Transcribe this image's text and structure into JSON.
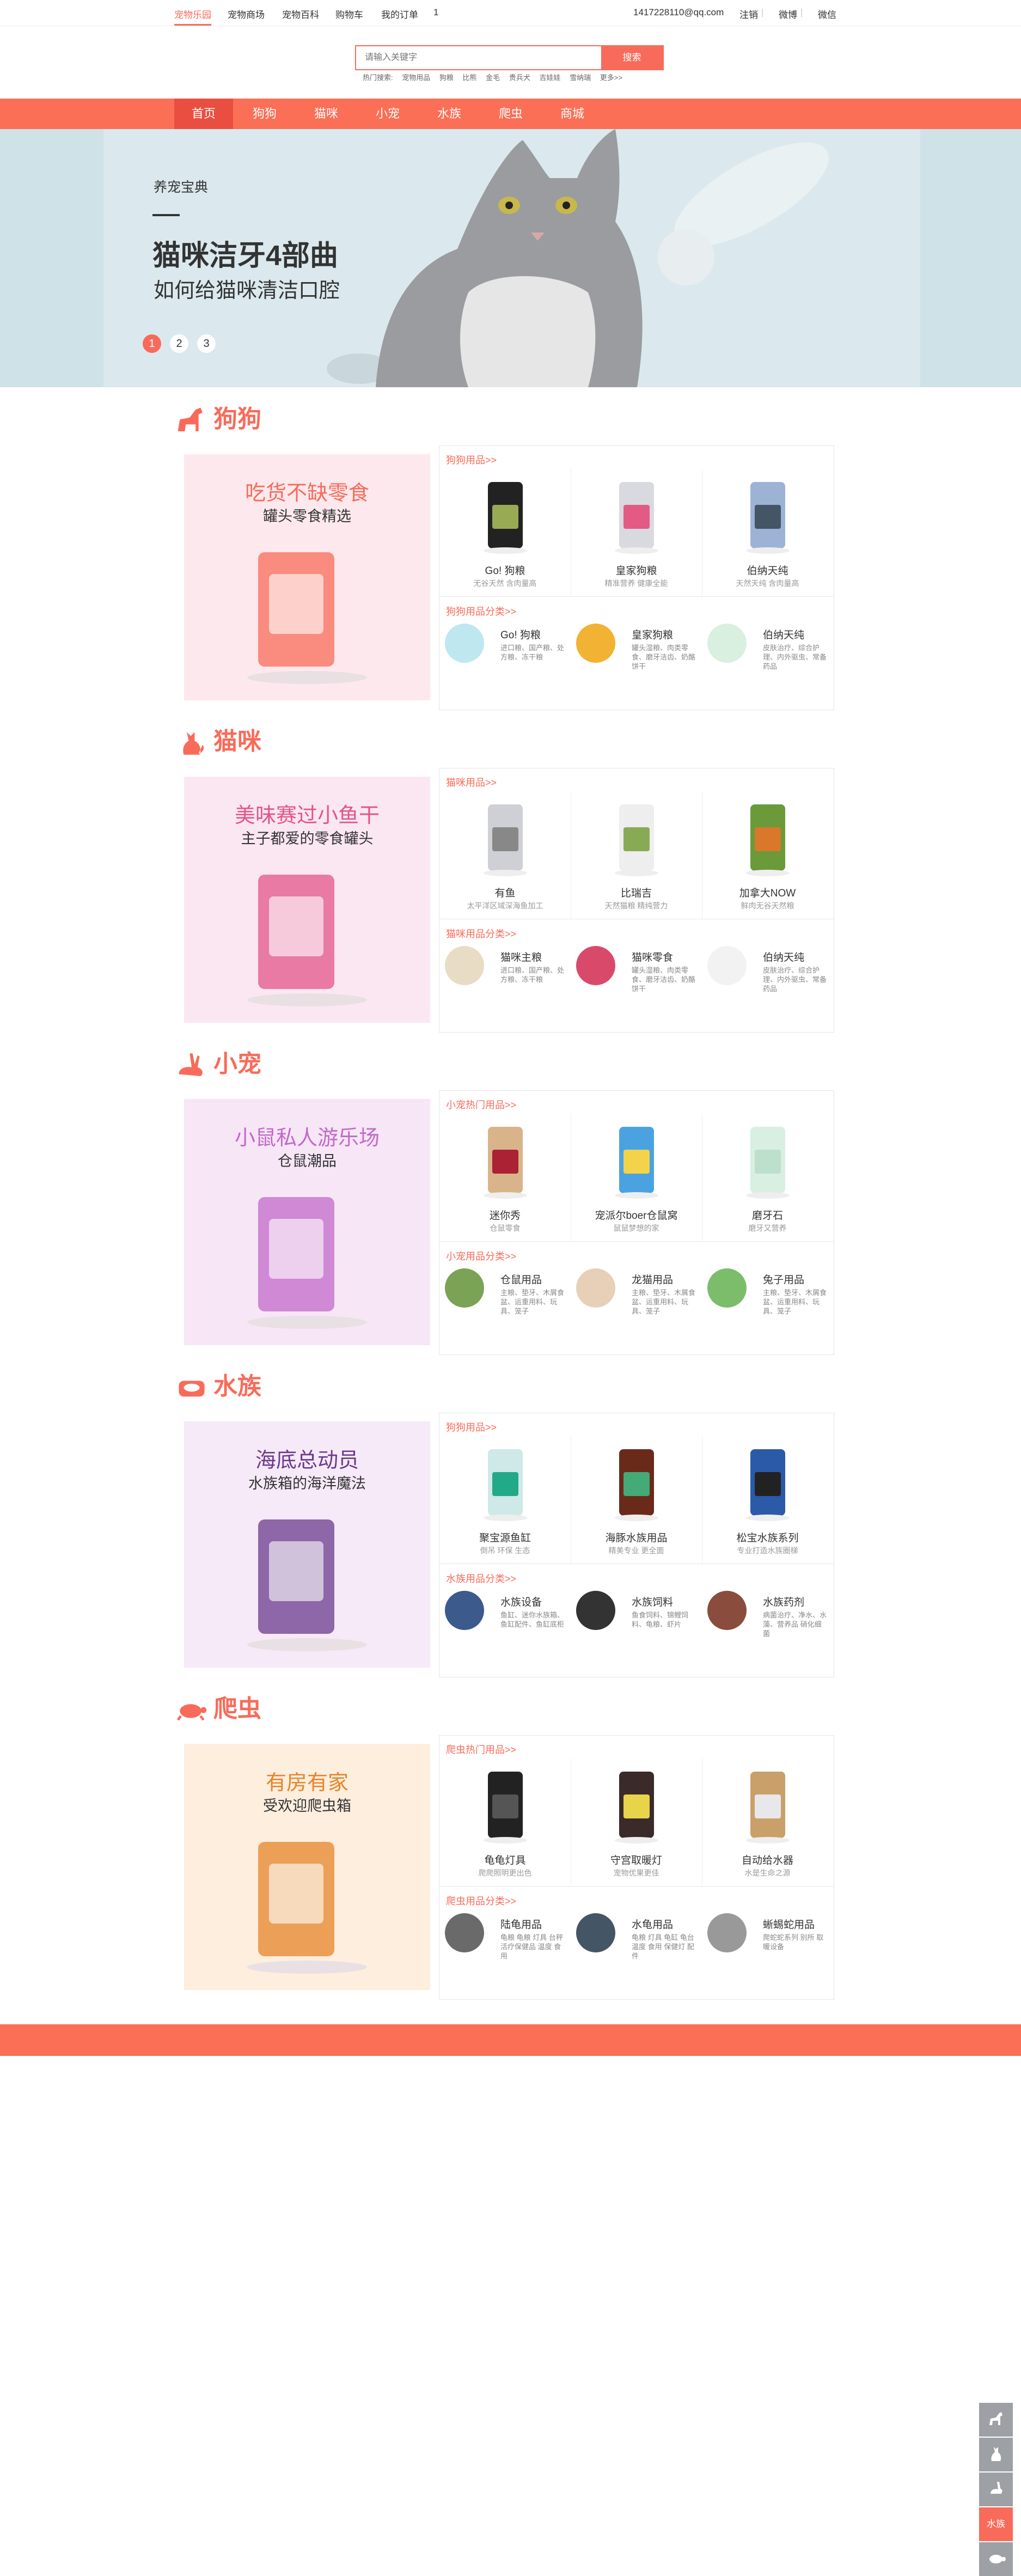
{
  "topbar": {
    "links": [
      "宠物乐园",
      "宠物商场",
      "宠物百科",
      "购物车",
      "我的订单",
      "1"
    ],
    "email": "1417228110@qq.com",
    "logout": "注销",
    "weibo": "微博",
    "wechat": "微信"
  },
  "search": {
    "placeholder": "请输入关键字",
    "button": "搜索",
    "hot_label": "热门搜索:",
    "hot": [
      "宠物用品",
      "狗粮",
      "比熊",
      "金毛",
      "贵兵犬",
      "吉娃娃",
      "雪纳瑞",
      "更多>>"
    ]
  },
  "nav": [
    "首页",
    "狗狗",
    "猫咪",
    "小宠",
    "水族",
    "爬虫",
    "商城"
  ],
  "banner": {
    "small": "养宠宝典",
    "title": "猫咪洁牙4部曲",
    "subtitle": "如何给猫咪清洁口腔",
    "dots": [
      "1",
      "2",
      "3"
    ]
  },
  "sections": [
    {
      "title": "狗狗",
      "promo_t1": "吃货不缺零食",
      "promo_t2": "罐头零食精选",
      "hot_label": "狗狗用品>>",
      "products": [
        {
          "name": "Go! 狗粮",
          "desc": "无谷天然 含肉量高"
        },
        {
          "name": "皇家狗粮",
          "desc": "精准营养 健康全能"
        },
        {
          "name": "伯纳天纯",
          "desc": "天然天纯 含肉量高"
        }
      ],
      "cat_label": "狗狗用品分类>>",
      "subs": [
        {
          "name": "Go! 狗粮",
          "desc": "进口粮、国产粮、处方粮、冻干粮"
        },
        {
          "name": "皇家狗粮",
          "desc": "罐头湿粮、肉类零食、磨牙洁齿、奶酪饼干"
        },
        {
          "name": "伯纳天纯",
          "desc": "皮肤治疗、综合护理、内外驱虫、常备药品"
        }
      ]
    },
    {
      "title": "猫咪",
      "promo_t1": "美味赛过小鱼干",
      "promo_t2": "主子都爱的零食罐头",
      "hot_label": "猫咪用品>>",
      "products": [
        {
          "name": "有鱼",
          "desc": "太平洋区域深海鱼加工"
        },
        {
          "name": "比瑞吉",
          "desc": "天然猫粮 精纯营力"
        },
        {
          "name": "加拿大NOW",
          "desc": "鲜肉无谷天然粮"
        }
      ],
      "cat_label": "猫咪用品分类>>",
      "subs": [
        {
          "name": "猫咪主粮",
          "desc": "进口粮、国产粮、处方粮、冻干粮"
        },
        {
          "name": "猫咪零食",
          "desc": "罐头湿粮、肉类零食、磨牙洁齿、奶酪饼干"
        },
        {
          "name": "伯纳天纯",
          "desc": "皮肤治疗、综合护理、内外驱虫、常备药品"
        }
      ]
    },
    {
      "title": "小宠",
      "promo_t1": "小鼠私人游乐场",
      "promo_t2": "仓鼠潮品",
      "hot_label": "小宠热门用品>>",
      "products": [
        {
          "name": "迷你秀",
          "desc": "仓鼠零食"
        },
        {
          "name": "宠派尔boer仓鼠窝",
          "desc": "鼠鼠梦想的家"
        },
        {
          "name": "磨牙石",
          "desc": "磨牙又营养"
        }
      ],
      "cat_label": "小宠用品分类>>",
      "subs": [
        {
          "name": "仓鼠用品",
          "desc": "主粮、垫牙、木屑食盆、运重用料、玩具、笼子"
        },
        {
          "name": "龙猫用品",
          "desc": "主粮、垫牙、木屑食盆、运重用料、玩具、笼子"
        },
        {
          "name": "兔子用品",
          "desc": "主粮、垫牙、木屑食盆、运重用料、玩具、笼子"
        }
      ]
    },
    {
      "title": "水族",
      "promo_t1": "海底总动员",
      "promo_t2": "水族箱的海洋魔法",
      "hot_label": "狗狗用品>>",
      "products": [
        {
          "name": "聚宝源鱼缸",
          "desc": "倒吊 环保 生态"
        },
        {
          "name": "海豚水族用品",
          "desc": "精美专业 更全面"
        },
        {
          "name": "松宝水族系列",
          "desc": "专业打造水族圈梯"
        }
      ],
      "cat_label": "水族用品分类>>",
      "subs": [
        {
          "name": "水族设备",
          "desc": "鱼缸、迷你水族箱、鱼缸配件、鱼缸底柜"
        },
        {
          "name": "水族饲料",
          "desc": "鱼食饲料、锦鲤饲料、龟粮、虾片"
        },
        {
          "name": "水族药剂",
          "desc": "病菌治疗、净水、水藻、营养品 硝化细菌"
        }
      ]
    },
    {
      "title": "爬虫",
      "promo_t1": "有房有家",
      "promo_t2": "受欢迎爬虫箱",
      "hot_label": "爬虫热门用品>>",
      "products": [
        {
          "name": "龟龟灯具",
          "desc": "爬爬照明更出色"
        },
        {
          "name": "守宫取暖灯",
          "desc": "宠物优果更佳"
        },
        {
          "name": "自动给水器",
          "desc": "水是生命之源"
        }
      ],
      "cat_label": "爬虫用品分类>>",
      "subs": [
        {
          "name": "陆龟用品",
          "desc": "龟粮 龟粮 灯具 台秤 活疗保健品 温度 食用"
        },
        {
          "name": "水龟用品",
          "desc": "龟粮 灯具 龟缸 龟台 温度 食用 保健灯 配件"
        },
        {
          "name": "蜥蜴蛇用品",
          "desc": "爬蛇蛇系列 别所 取暖设备"
        }
      ]
    }
  ],
  "sidebar": [
    "水族"
  ],
  "colors": {
    "accent": "#f86b5a",
    "nav": "#fa6f56"
  }
}
